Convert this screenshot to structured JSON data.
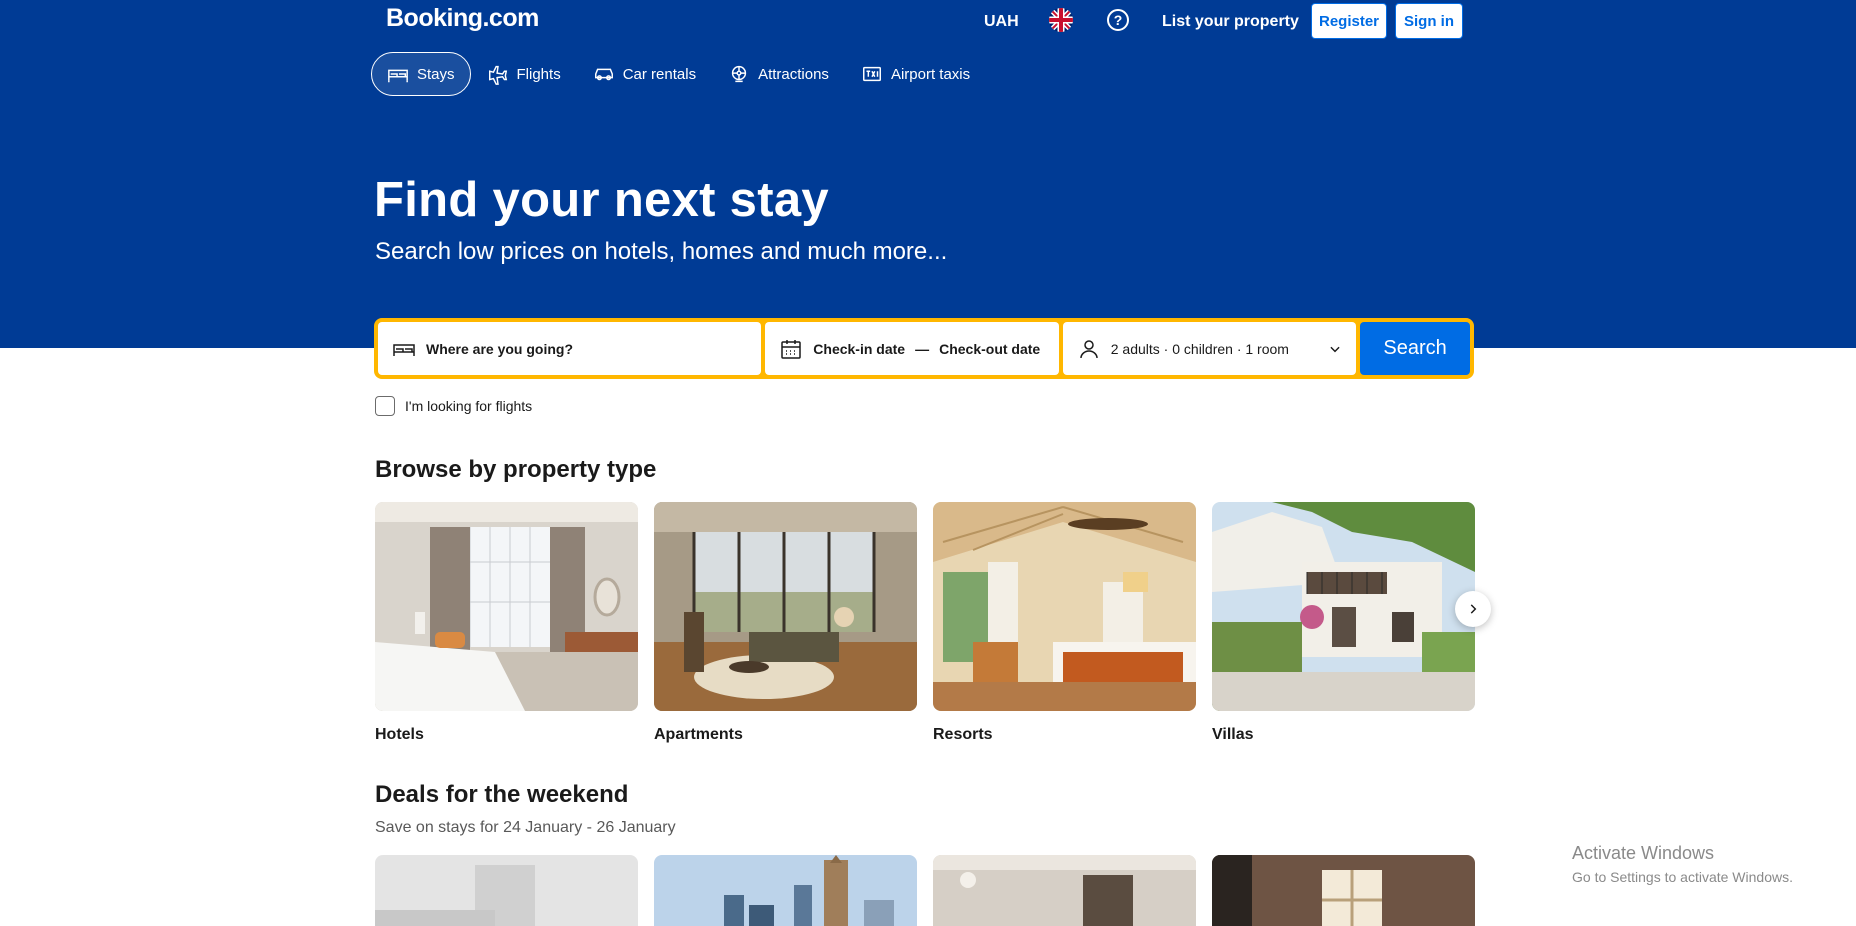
{
  "header": {
    "logo": "Booking.com",
    "currency": "UAH",
    "help_glyph": "?",
    "list_property": "List your property",
    "register": "Register",
    "sign_in": "Sign in"
  },
  "nav": {
    "items": [
      {
        "label": "Stays",
        "icon": "bed-icon",
        "active": true
      },
      {
        "label": "Flights",
        "icon": "plane-icon",
        "active": false
      },
      {
        "label": "Car rentals",
        "icon": "car-icon",
        "active": false
      },
      {
        "label": "Attractions",
        "icon": "attractions-icon",
        "active": false
      },
      {
        "label": "Airport taxis",
        "icon": "taxi-icon",
        "active": false
      }
    ]
  },
  "hero": {
    "title": "Find your next stay",
    "subtitle": "Search low prices on hotels, homes and much more..."
  },
  "search": {
    "destination_placeholder": "Where are you going?",
    "checkin": "Check-in date",
    "dash": "—",
    "checkout": "Check-out date",
    "occupancy": "2 adults · 0 children · 1 room",
    "button": "Search",
    "flights_checkbox": "I'm looking for flights"
  },
  "browse": {
    "title": "Browse by property type",
    "items": [
      {
        "label": "Hotels"
      },
      {
        "label": "Apartments"
      },
      {
        "label": "Resorts"
      },
      {
        "label": "Villas"
      }
    ]
  },
  "deals": {
    "title": "Deals for the weekend",
    "subtitle": "Save on stays for 24 January - 26 January"
  },
  "watermark": {
    "title": "Activate Windows",
    "subtitle": "Go to Settings to activate Windows."
  },
  "colors": {
    "brand": "#003b95",
    "accent": "#006ce4",
    "search_border": "#ffb700"
  }
}
